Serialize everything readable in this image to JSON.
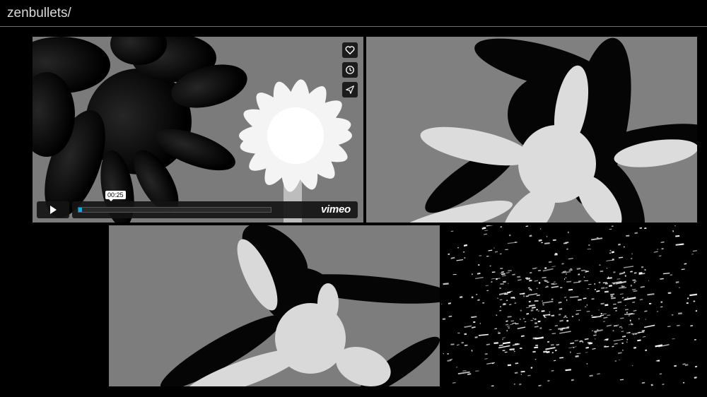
{
  "site": {
    "title": "zenbullets/"
  },
  "player": {
    "current_time": "00:25",
    "progress": 0.02,
    "brand": "vimeo",
    "accent_color": "#00adef",
    "icons": [
      "heart-icon",
      "clock-icon",
      "send-icon",
      "play-icon",
      "volume-icon",
      "gear-icon",
      "fullscreen-icon"
    ]
  },
  "tiles": [
    {
      "subject": "white and black flower shapes render"
    },
    {
      "subject": "white star shape with black shadow"
    },
    {
      "subject": "white blob with black arms"
    },
    {
      "subject": "white particle streaks on black"
    }
  ]
}
